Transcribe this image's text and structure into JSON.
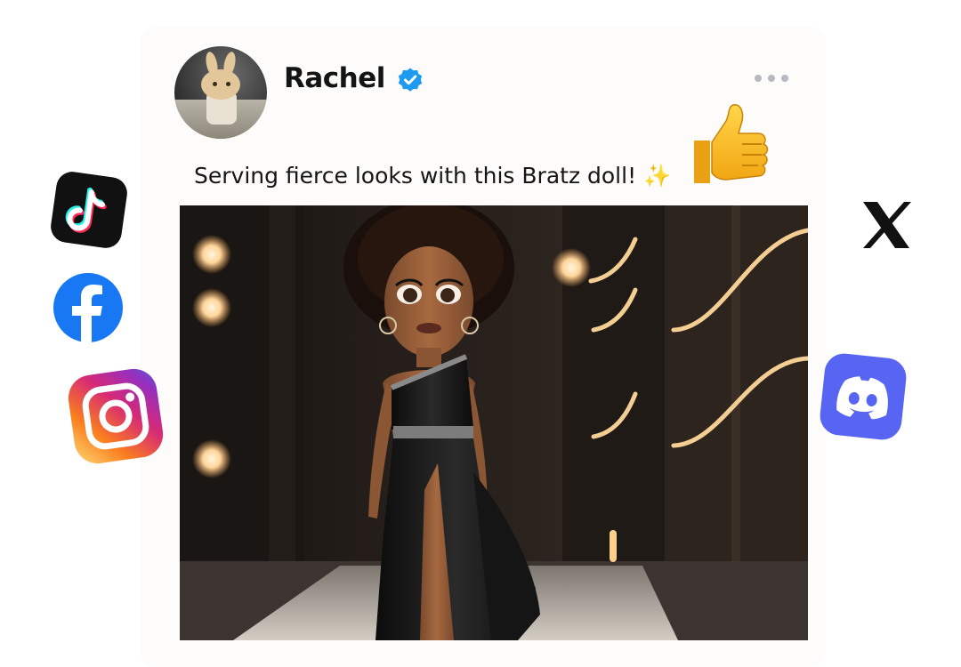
{
  "post": {
    "author_name": "Rachel",
    "verified": true,
    "caption": "Serving fierce looks with this Bratz doll!",
    "caption_emoji": "✨",
    "reaction_emoji": "thumbs-up",
    "menu_icon": "more-horizontal-icon"
  },
  "social_icons": [
    {
      "name": "tiktok-icon",
      "label": "TikTok"
    },
    {
      "name": "facebook-icon",
      "label": "Facebook"
    },
    {
      "name": "instagram-icon",
      "label": "Instagram"
    },
    {
      "name": "x-icon",
      "label": "X"
    },
    {
      "name": "discord-icon",
      "label": "Discord"
    }
  ],
  "colors": {
    "verified_blue": "#1d9bf0",
    "facebook_blue": "#1877f2",
    "discord_blurple": "#5865f2",
    "tiktok_black": "#111111"
  }
}
